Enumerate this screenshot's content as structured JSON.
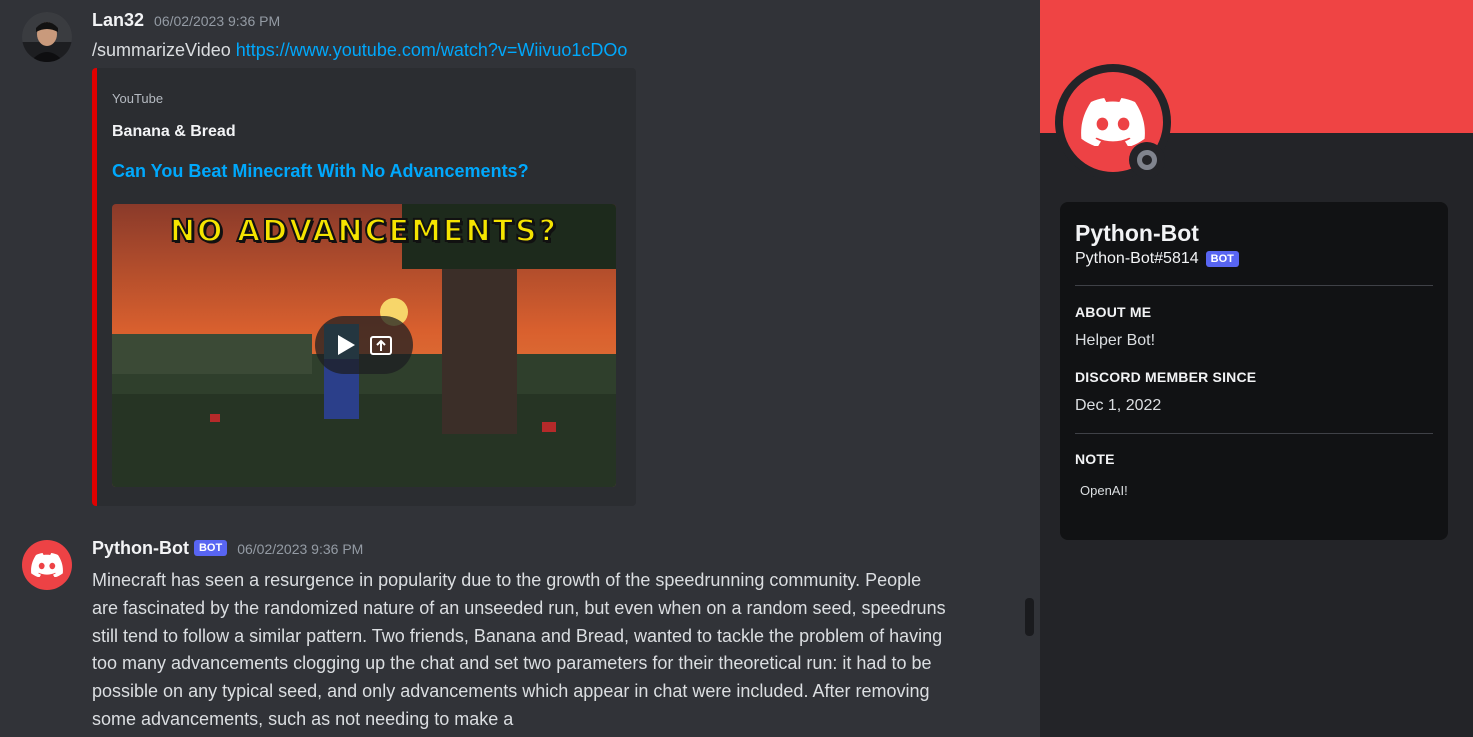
{
  "messages": [
    {
      "author": "Lan32",
      "timestamp": "06/02/2023 9:36 PM",
      "command": "/summarizeVideo",
      "link": "https://www.youtube.com/watch?v=Wiivuo1cDOo",
      "embed": {
        "provider": "YouTube",
        "author": "Banana & Bread",
        "title": "Can You Beat Minecraft With No Advancements?",
        "thumbnail_caption": "NO ADVANCEMENTS?",
        "border_color": "#e00000"
      }
    },
    {
      "author": "Python-Bot",
      "bot_tag": "BOT",
      "timestamp": "06/02/2023 9:36 PM",
      "text": "Minecraft has seen a resurgence in popularity due to the growth of the speedrunning community. People are fascinated by the randomized nature of an unseeded run, but even when on a random seed, speedruns still tend to follow a similar pattern. Two friends, Banana and Bread, wanted to tackle the problem of having too many advancements clogging up the chat and set two parameters for their theoretical run: it had to be possible on any typical seed, and only advancements which appear in chat were included. After removing some advancements, such as not needing to make a"
    }
  ],
  "profile": {
    "display_name": "Python-Bot",
    "username": "Python-Bot#5814",
    "bot_tag": "BOT",
    "about_me_heading": "ABOUT ME",
    "about_me": "Helper Bot!",
    "member_since_heading": "DISCORD MEMBER SINCE",
    "member_since": "Dec 1, 2022",
    "note_heading": "NOTE",
    "note": "OpenAI!",
    "banner_color": "#ef4444",
    "status": "offline"
  },
  "colors": {
    "accent_blurple": "#5865f2",
    "link": "#00a8fc",
    "discord_red": "#ed4245"
  }
}
